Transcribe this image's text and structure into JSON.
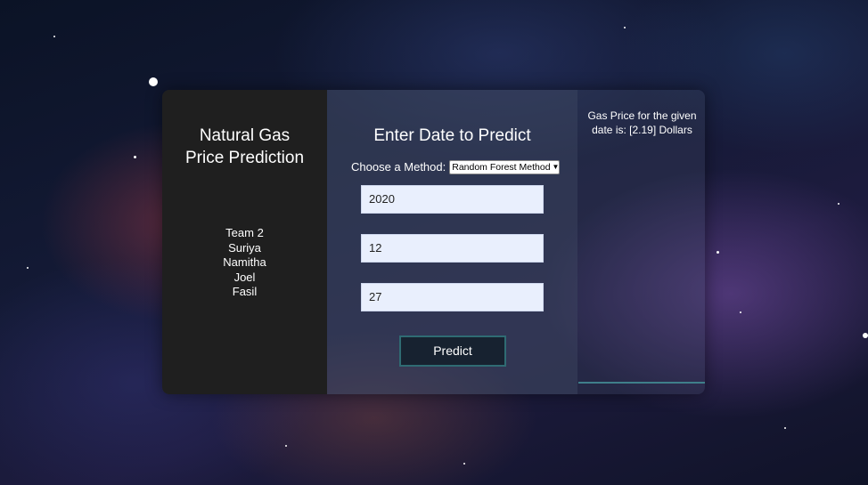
{
  "sidebar": {
    "title": "Natural Gas\nPrice Prediction",
    "team_label": "Team 2",
    "members": [
      "Suriya",
      "Namitha",
      "Joel",
      "Fasil"
    ]
  },
  "form": {
    "title": "Enter Date to Predict",
    "method_label": "Choose a Method:",
    "method_selected": "Random Forest Method",
    "year_value": "2020",
    "month_value": "12",
    "day_value": "27",
    "predict_label": "Predict"
  },
  "result": {
    "text": "Gas Price for the given date is: [2.19] Dollars"
  },
  "colors": {
    "sidebar_bg": "#1f1f1f",
    "input_bg": "#e9effd",
    "button_border": "#2f6b73",
    "accent_line": "#3f7f8a"
  },
  "icons": {
    "select_chevron": "chevron-down-icon"
  }
}
